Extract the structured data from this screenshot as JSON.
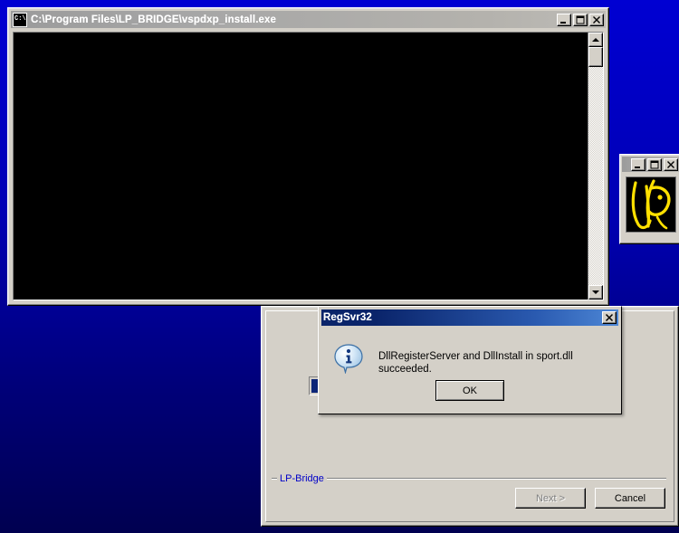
{
  "desktop": {
    "background_top_color": "#0000d2",
    "background_bottom_color": "#000050"
  },
  "console_window": {
    "title": "C:\\Program Files\\LP_BRIDGE\\vspdxp_install.exe",
    "icon_glyph": "C:\\",
    "content_text": "",
    "background_color": "#000000",
    "state": "inactive",
    "buttons": {
      "minimize_label": "Minimize",
      "maximize_label": "Maximize",
      "close_label": "Close"
    },
    "scrollbar": {
      "up_label": "Scroll up",
      "down_label": "Scroll down"
    }
  },
  "logo_window": {
    "title": "",
    "logo_alt": "LP yellow monogram",
    "logo_color": "#ffe000",
    "logo_background": "#000000",
    "buttons": {
      "minimize_label": "Minimize",
      "maximize_label": "Maximize",
      "close_label": "Close"
    }
  },
  "installer_window": {
    "brand_label": "LP-Bridge",
    "brand_color": "#0000c8",
    "progress_color": "#0c2577",
    "next_label": "Next >",
    "next_enabled": false,
    "cancel_label": "Cancel",
    "cancel_enabled": true
  },
  "regsvr_dialog": {
    "title": "RegSvr32",
    "message": "DllRegisterServer and DllInstall in sport.dll succeeded.",
    "ok_label": "OK",
    "icon": "info-icon",
    "close_label": "Close",
    "titlebar_color": "#0a246a"
  }
}
